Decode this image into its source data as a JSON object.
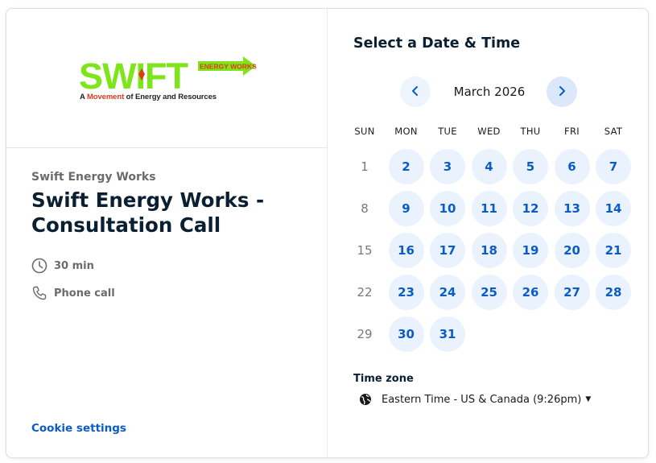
{
  "logo": {
    "brand": "SWIFT",
    "badge": "ENERGY WORKS",
    "tagline_prefix": "A ",
    "tagline_highlight": "Movement",
    "tagline_suffix": " of Energy and Resources",
    "colors": {
      "green": "#7ee51a",
      "red": "#e03a1e",
      "dark": "#222222"
    }
  },
  "event": {
    "owner": "Swift Energy Works",
    "title": "Swift Energy Works - Consultation Call",
    "duration": "30 min",
    "location": "Phone call"
  },
  "footer": {
    "cookie_label": "Cookie settings"
  },
  "calendar": {
    "heading": "Select a Date & Time",
    "month_label": "March 2026",
    "weekdays": [
      "SUN",
      "MON",
      "TUE",
      "WED",
      "THU",
      "FRI",
      "SAT"
    ],
    "weeks": [
      [
        {
          "d": "1",
          "a": false
        },
        {
          "d": "2",
          "a": true
        },
        {
          "d": "3",
          "a": true
        },
        {
          "d": "4",
          "a": true
        },
        {
          "d": "5",
          "a": true
        },
        {
          "d": "6",
          "a": true
        },
        {
          "d": "7",
          "a": true
        }
      ],
      [
        {
          "d": "8",
          "a": false
        },
        {
          "d": "9",
          "a": true
        },
        {
          "d": "10",
          "a": true
        },
        {
          "d": "11",
          "a": true
        },
        {
          "d": "12",
          "a": true
        },
        {
          "d": "13",
          "a": true
        },
        {
          "d": "14",
          "a": true
        }
      ],
      [
        {
          "d": "15",
          "a": false
        },
        {
          "d": "16",
          "a": true
        },
        {
          "d": "17",
          "a": true
        },
        {
          "d": "18",
          "a": true
        },
        {
          "d": "19",
          "a": true
        },
        {
          "d": "20",
          "a": true
        },
        {
          "d": "21",
          "a": true
        }
      ],
      [
        {
          "d": "22",
          "a": false
        },
        {
          "d": "23",
          "a": true
        },
        {
          "d": "24",
          "a": true
        },
        {
          "d": "25",
          "a": true
        },
        {
          "d": "26",
          "a": true
        },
        {
          "d": "27",
          "a": true
        },
        {
          "d": "28",
          "a": true
        }
      ],
      [
        {
          "d": "29",
          "a": false
        },
        {
          "d": "30",
          "a": true
        },
        {
          "d": "31",
          "a": true
        }
      ]
    ],
    "accent": "#0b5cc4"
  },
  "timezone": {
    "label": "Time zone",
    "value": "Eastern Time - US & Canada (9:26pm)"
  }
}
